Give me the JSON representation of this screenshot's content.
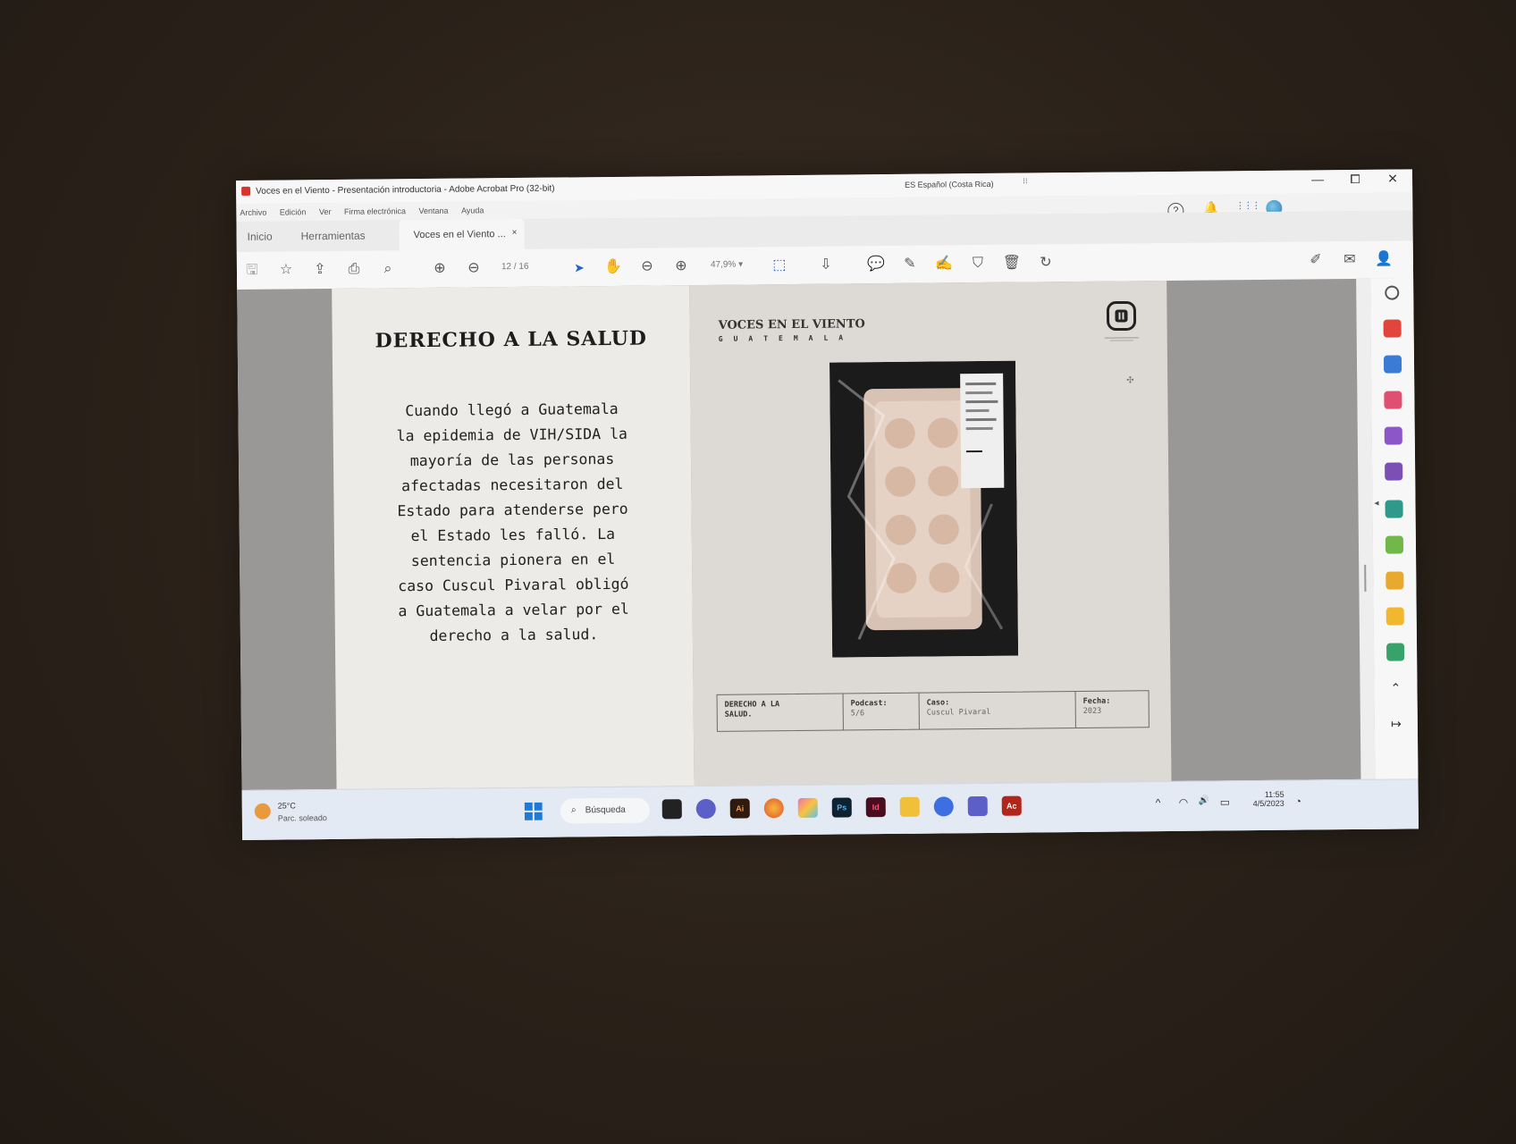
{
  "window": {
    "title": "Voces en el Viento - Presentación introductoria - Adobe Acrobat Pro (32-bit)",
    "language_indicator": "ES Español (Costa Rica)",
    "minimize_glyph": "—",
    "maximize_glyph": "⧠",
    "close_glyph": "✕"
  },
  "menu": {
    "items": [
      "Archivo",
      "Edición",
      "Ver",
      "Firma electrónica",
      "Ventana",
      "Ayuda"
    ],
    "help_glyph": "?",
    "bell_glyph": "🔔",
    "apps_glyph": "⋮⋮⋮"
  },
  "tabs": {
    "home": "Inicio",
    "tools": "Herramientas",
    "document": "Voces en el Viento ...",
    "close_glyph": "×"
  },
  "toolbar": {
    "page_current": "12",
    "page_total": "/ 16",
    "zoom": "47,9%",
    "zoom_caret": "▾",
    "icons": {
      "save": "🖫",
      "bookmark": "☆",
      "upload": "⇪",
      "print": "⎙",
      "search": "⌕",
      "prev": "⊕",
      "next": "⊖",
      "select": "➤",
      "hand": "✋",
      "zoom_out": "⊖",
      "zoom_in": "⊕",
      "fit": "⬚",
      "scroll": "⇩",
      "comment": "💬",
      "highlight": "✎",
      "sign": "✍",
      "stamp": "⛉",
      "delete": "🗑",
      "rotate": "↻",
      "share": "✐",
      "mail": "✉",
      "account": "👤"
    }
  },
  "document": {
    "left_page": {
      "title": "DERECHO A LA SALUD",
      "body_lines": [
        "Cuando llegó a Guatemala",
        "la epidemia de VIH/SIDA la",
        "mayoría de las personas",
        "afectadas necesitaron del",
        "Estado para atenderse pero",
        "el Estado les falló. La",
        "sentencia pionera en el",
        "caso Cuscul Pivaral obligó",
        "a Guatemala a velar por el",
        "derecho a la salud."
      ]
    },
    "right_page": {
      "brand": "VOCES EN EL VIENTO",
      "brand_sub": "GUATEMALA",
      "meta": [
        {
          "key": "DERECHO A LA",
          "value": "SALUD."
        },
        {
          "key": "Podcast:",
          "value": "5/6"
        },
        {
          "key": "Caso:",
          "value": "Cuscul Pivaral"
        },
        {
          "key": "Fecha:",
          "value": "2023"
        }
      ]
    }
  },
  "taskbar": {
    "weather_temp": "25°C",
    "weather_desc": "Parc. soleado",
    "search_label": "Búsqueda",
    "search_glyph": "⌕",
    "apps": [
      {
        "name": "Ai",
        "color": "#2f1a0d"
      },
      {
        "name": "Id",
        "color": "#4a0d1f"
      },
      {
        "name": "Ps",
        "color": "#0e2232"
      },
      {
        "name": "Ac",
        "color": "#b3241b"
      }
    ],
    "time": "11:55",
    "date": "4/5/2023",
    "tray": {
      "caret": "^",
      "wifi": "◠",
      "volume": "🔊",
      "battery": "▭"
    }
  },
  "colors": {
    "accent_blue": "#2762c8",
    "acrobat_red": "#d8342a",
    "page_background": "#ddd9d4"
  }
}
